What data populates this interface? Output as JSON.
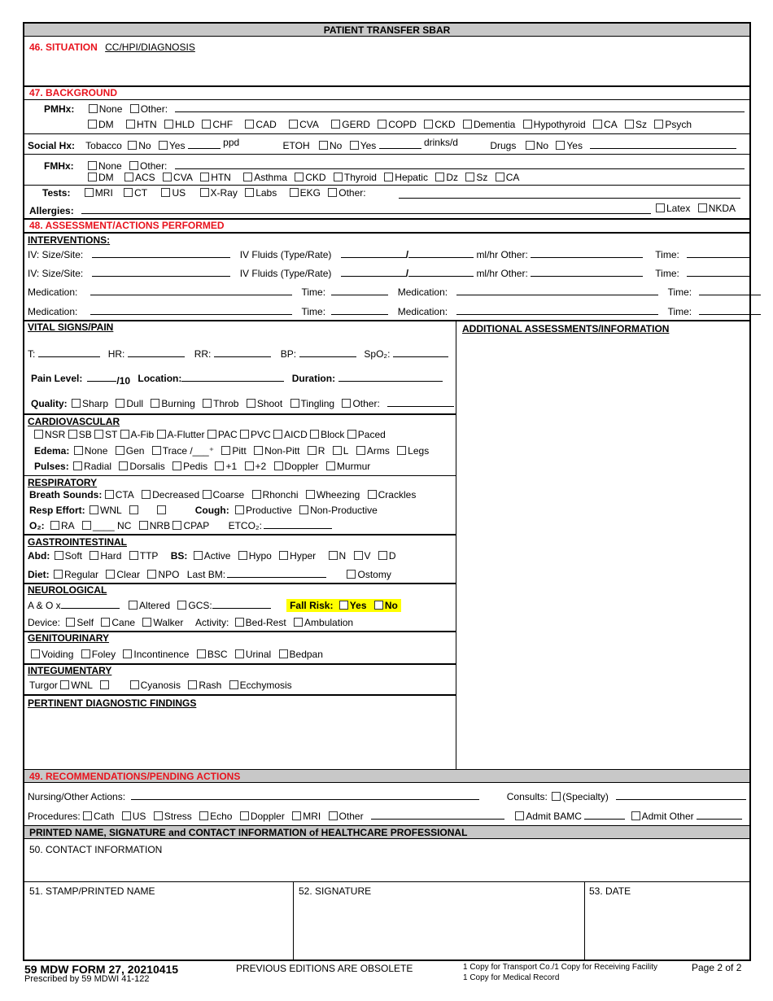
{
  "title": "PATIENT TRANSFER SBAR",
  "situation": {
    "number_label": "46. SITUATION",
    "sub_label": "CC/HPI/DIAGNOSIS"
  },
  "background": {
    "label": "47. BACKGROUND",
    "pmhx": {
      "label": "PMHx:",
      "options_row1": [
        "None",
        "Other:"
      ],
      "options_row2": [
        "DM",
        "HTN",
        "HLD",
        "CHF",
        "CAD",
        "CVA",
        "GERD",
        "COPD",
        "CKD",
        "Dementia",
        "Hypothyroid",
        "CA",
        "Sz",
        "Psych"
      ]
    },
    "social": {
      "label": "Social Hx:",
      "tobacco": "Tobacco",
      "no": "No",
      "yes": "Yes",
      "ppd": "ppd",
      "etoh": "ETOH",
      "drinks": "drinks/d",
      "drugs": "Drugs"
    },
    "fmhx": {
      "label": "FMHx:",
      "options_row1": [
        "None",
        "Other:"
      ],
      "options_row2": [
        "DM",
        "ACS",
        "CVA",
        "HTN",
        "Asthma",
        "CKD",
        "Thyroid",
        "Hepatic",
        "Dz",
        "Sz",
        "CA"
      ]
    },
    "tests": {
      "label": "Tests:",
      "options": [
        "MRI",
        "CT",
        "US",
        "X-Ray",
        "Labs",
        "EKG",
        "Other:"
      ]
    },
    "allergies": {
      "label": "Allergies:",
      "options": [
        "Latex",
        "NKDA"
      ]
    }
  },
  "assessment": {
    "label": "48. ASSESSMENT/ACTIONS PERFORMED",
    "interventions": {
      "title": "INTERVENTIONS:",
      "iv_site": "IV: Size/Site:",
      "iv_fluids": "IV Fluids (Type/Rate)",
      "slash": "/",
      "mlhr_other": "ml/hr  Other:",
      "time": "Time:",
      "medication": "Medication:"
    },
    "vitals": {
      "title": "VITAL SIGNS/PAIN",
      "t": "T:",
      "hr": "HR:",
      "rr": "RR:",
      "bp": "BP:",
      "spo2": "SpO₂:",
      "pain_level": "Pain Level:",
      "per10": "/10",
      "location": "Location:",
      "duration": "Duration:",
      "quality": "Quality:",
      "quality_options": [
        "Sharp",
        "Dull",
        "Burning",
        "Throb",
        "Shoot",
        "Tingling",
        "Other:"
      ]
    },
    "additional": {
      "title": "ADDITIONAL ASSESSMENTS/INFORMATION"
    },
    "cardio": {
      "title": "CARDIOVASCULAR",
      "rhythms": [
        "NSR",
        "SB",
        "ST",
        "A-Fib",
        "A-Flutter",
        "PAC",
        "PVC",
        "AICD",
        "Block",
        "Paced"
      ],
      "edema_label": "Edema:",
      "edema_options_a": [
        "None",
        "Gen",
        "Trace"
      ],
      "edema_plus": "/___⁺",
      "edema_options_b": [
        "Pitt",
        "Non-Pitt",
        "R",
        "L",
        "Arms",
        "Legs"
      ],
      "pulses_label": "Pulses:",
      "pulses_options": [
        "Radial",
        "Dorsalis",
        "Pedis",
        "+1",
        "+2",
        "Doppler",
        "Murmur"
      ]
    },
    "resp": {
      "title": "RESPIRATORY",
      "breath_label": "Breath Sounds:",
      "breath_options": [
        "CTA",
        "Decreased",
        "Coarse",
        "Rhonchi",
        "Wheezing",
        "Crackles"
      ],
      "effort_label": "Resp Effort:",
      "effort_options": [
        "WNL",
        "",
        ""
      ],
      "cough_label": "Cough:",
      "cough_options": [
        "Productive",
        "Non-Productive"
      ],
      "o2_label": "O₂:",
      "o2_options": [
        "RA",
        "____ NC",
        "NRB",
        "CPAP"
      ],
      "etco2": "ETCO₂:"
    },
    "gi": {
      "title": "GASTROINTESTINAL",
      "abd_label": "Abd:",
      "abd_options": [
        "Soft",
        "Hard",
        "TTP"
      ],
      "bs_label": "BS:",
      "bs_options": [
        "Active",
        "Hypo",
        "Hyper",
        "N",
        "V",
        "D"
      ],
      "diet_label": "Diet:",
      "diet_options": [
        "Regular",
        "Clear",
        "NPO"
      ],
      "last_bm": "Last BM:",
      "ostomy": "Ostomy"
    },
    "neuro": {
      "title": "NEUROLOGICAL",
      "aox": "A & O x",
      "altered": "Altered",
      "gcs": "GCS:",
      "fall_risk": "Fall Risk:",
      "fall_yes": "Yes",
      "fall_no": "No",
      "device_label": "Device:",
      "device_options": [
        "Self",
        "Cane",
        "Walker"
      ],
      "activity_label": "Activity:",
      "activity_options": [
        "Bed-Rest",
        "Ambulation"
      ],
      "highlight_color": "#ffff00"
    },
    "gu": {
      "title": "GENITOURINARY",
      "options": [
        "Voiding",
        "Foley",
        "Incontinence",
        "BSC",
        "Urinal",
        "Bedpan"
      ]
    },
    "integ": {
      "title": "INTEGUMENTARY",
      "turgor": "Turgor",
      "options": [
        "WNL",
        "",
        "Cyanosis",
        "Rash",
        "Ecchymosis"
      ]
    },
    "diag": {
      "title": "PERTINENT DIAGNOSTIC FINDINGS"
    }
  },
  "recommendations": {
    "label": "49. RECOMMENDATIONS/PENDING ACTIONS",
    "nursing": "Nursing/Other Actions:",
    "consults": "Consults:",
    "specialty": "(Specialty)",
    "procedures_label": "Procedures:",
    "procedures": [
      "Cath",
      "US",
      "Stress",
      "Echo",
      "Doppler",
      "MRI",
      "Other"
    ],
    "admit_bamc": "Admit BAMC",
    "admit_other": "Admit Other"
  },
  "signature": {
    "header": "PRINTED NAME, SIGNATURE and CONTACT INFORMATION of HEALTHCARE PROFESSIONAL",
    "contact": "50.  CONTACT INFORMATION",
    "stamp": "51.  STAMP/PRINTED NAME",
    "sig": "52.  SIGNATURE",
    "date": "53.  DATE"
  },
  "footer": {
    "form_id": "59 MDW FORM 27, 20210415",
    "prescribed": "Prescribed by 59 MDWI 41-122",
    "obsolete": "PREVIOUS EDITIONS  ARE OBSOLETE",
    "copy1": "1 Copy for Transport Co./1 Copy for Receiving Facility",
    "copy2": "1 Copy for Medical Record",
    "page": "Page 2 of 2"
  },
  "colors": {
    "section_red": "#e8131d",
    "header_gray": "#c8c8c8",
    "highlight": "#ffff00"
  }
}
